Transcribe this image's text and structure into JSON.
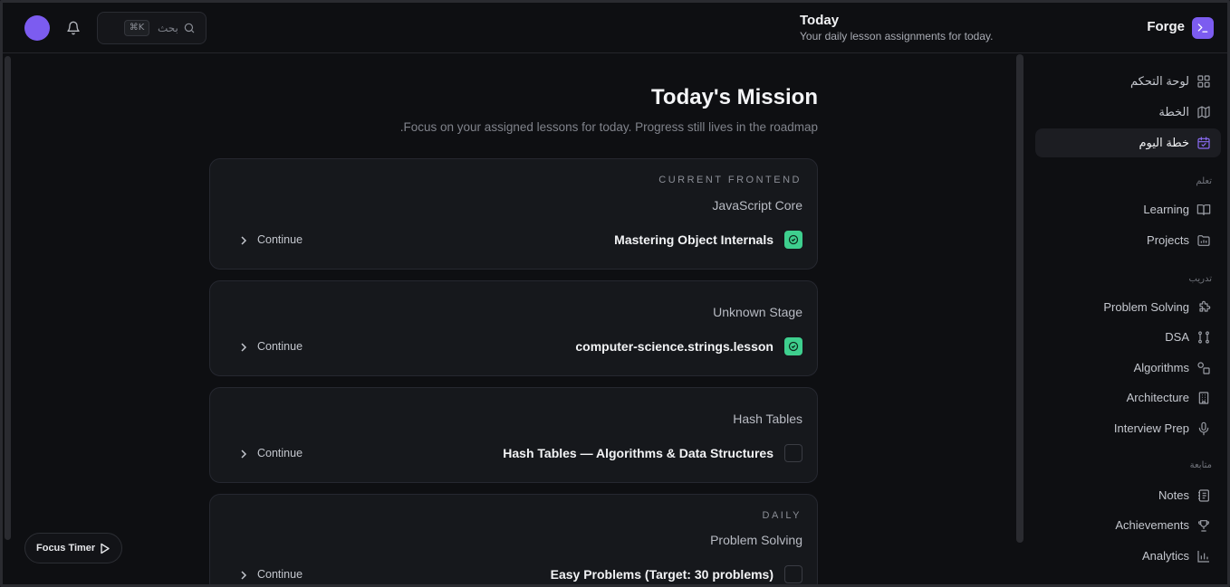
{
  "header": {
    "search_label": "بحث",
    "search_shortcut": "⌘K",
    "page_title": "Today",
    "page_subtitle": "Your daily lesson assignments for today.",
    "brand": "Forge"
  },
  "main": {
    "title": "Today's Mission",
    "subtitle": "Focus on your assigned lessons for today. Progress still lives in the roadmap.",
    "cards": [
      {
        "tag": "CURRENT FRONTEND",
        "stage": "JavaScript Core",
        "lesson": "Mastering Object Internals",
        "status": "done",
        "action": "Continue"
      },
      {
        "tag": "",
        "stage": "Unknown Stage",
        "lesson": "computer-science.strings.lesson",
        "status": "done",
        "action": "Continue"
      },
      {
        "tag": "",
        "stage": "Hash Tables",
        "lesson": "Hash Tables — Algorithms & Data Structures",
        "status": "todo",
        "action": "Continue"
      },
      {
        "tag": "DAILY",
        "stage": "Problem Solving",
        "lesson": "Easy Problems (Target: 30 problems)",
        "status": "todo",
        "action": "Continue"
      }
    ]
  },
  "focus_timer": {
    "label": "Focus Timer"
  },
  "sidebar": {
    "items_top": [
      {
        "label": "لوحة التحكم",
        "icon": "grid-icon"
      },
      {
        "label": "الخطة",
        "icon": "map-icon"
      },
      {
        "label": "خطة اليوم",
        "icon": "calendar-check-icon",
        "active": true
      }
    ],
    "section_learn": "تعلم",
    "items_learn": [
      {
        "label": "Learning",
        "icon": "book-icon"
      },
      {
        "label": "Projects",
        "icon": "folder-icon"
      }
    ],
    "section_practice": "تدريب",
    "items_practice": [
      {
        "label": "Problem Solving",
        "icon": "puzzle-icon"
      },
      {
        "label": "DSA",
        "icon": "nodes-icon"
      },
      {
        "label": "Algorithms",
        "icon": "shapes-icon"
      },
      {
        "label": "Architecture",
        "icon": "building-icon"
      },
      {
        "label": "Interview Prep",
        "icon": "mic-icon"
      }
    ],
    "section_follow": "متابعة",
    "items_follow": [
      {
        "label": "Notes",
        "icon": "notebook-icon"
      },
      {
        "label": "Achievements",
        "icon": "trophy-icon"
      },
      {
        "label": "Analytics",
        "icon": "bar-chart-icon"
      }
    ]
  },
  "colors": {
    "accent": "#7c5cf0",
    "success": "#3ecf8e",
    "background": "#0e0f12",
    "card": "#16181c"
  }
}
